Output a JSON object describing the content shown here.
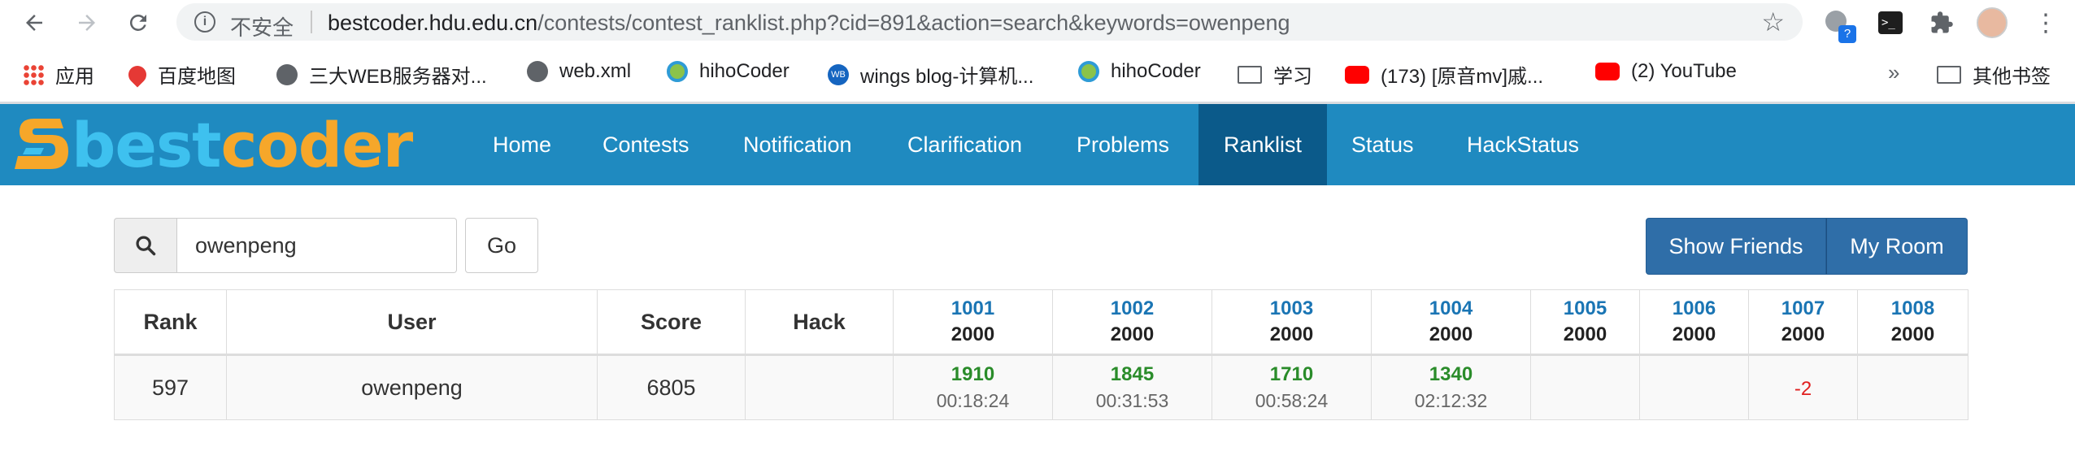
{
  "browser": {
    "insecure_label": "不安全",
    "url_host": "bestcoder.hdu.edu.cn",
    "url_path": "/contests/contest_ranklist.php?cid=891&action=search&keywords=owenpeng",
    "bookmarks": [
      {
        "label": "应用",
        "icon": "apps-grid-icon"
      },
      {
        "label": "百度地图",
        "icon": "map-pin-icon"
      },
      {
        "label": "三大WEB服务器对...",
        "icon": "globe-icon"
      },
      {
        "label": "web.xml",
        "icon": "globe-icon"
      },
      {
        "label": "hihoCoder",
        "icon": "hihocoder-icon"
      },
      {
        "label": "wings blog-计算机...",
        "icon": "wb-icon"
      },
      {
        "label": "hihoCoder",
        "icon": "hihocoder-icon"
      },
      {
        "label": "学习",
        "icon": "folder-icon"
      },
      {
        "label": "(173) [原音mv]戚...",
        "icon": "youtube-icon"
      },
      {
        "label": "(2) YouTube",
        "icon": "youtube-icon"
      }
    ],
    "overflow_label": "»",
    "other_bookmarks": "其他书签",
    "ext_badge": "?"
  },
  "site": {
    "nav": [
      "Home",
      "Contests",
      "Notification",
      "Clarification",
      "Problems",
      "Ranklist",
      "Status",
      "HackStatus"
    ],
    "active_nav": "Ranklist",
    "logo_text_best": "best",
    "logo_text_coder": "coder",
    "colors": {
      "nav_bg": "#1f8ac0",
      "nav_active": "#0b5a8a",
      "accept": "#2a8c2a",
      "fail": "#e02020",
      "problem_id": "#1a75b4"
    }
  },
  "search": {
    "value": "owenpeng",
    "go_label": "Go"
  },
  "buttons": {
    "show_friends": "Show Friends",
    "my_room": "My Room"
  },
  "table": {
    "headers": {
      "rank": "Rank",
      "user": "User",
      "score": "Score",
      "hack": "Hack"
    },
    "problems": [
      {
        "id": "1001",
        "score": "2000"
      },
      {
        "id": "1002",
        "score": "2000"
      },
      {
        "id": "1003",
        "score": "2000"
      },
      {
        "id": "1004",
        "score": "2000"
      },
      {
        "id": "1005",
        "score": "2000"
      },
      {
        "id": "1006",
        "score": "2000"
      },
      {
        "id": "1007",
        "score": "2000"
      },
      {
        "id": "1008",
        "score": "2000"
      }
    ],
    "rows": [
      {
        "rank": "597",
        "user": "owenpeng",
        "score": "6805",
        "hack": "",
        "results": [
          {
            "score": "1910",
            "time": "00:18:24"
          },
          {
            "score": "1845",
            "time": "00:31:53"
          },
          {
            "score": "1710",
            "time": "00:58:24"
          },
          {
            "score": "1340",
            "time": "02:12:32"
          },
          {},
          {},
          {
            "fail": "-2"
          },
          {}
        ]
      }
    ]
  }
}
